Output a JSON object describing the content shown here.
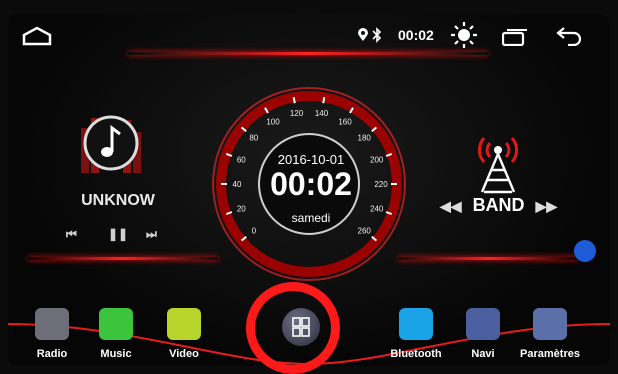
{
  "status_bar": {
    "home_icon": "home-outline-icon",
    "location_icon": "location-pin-icon",
    "bluetooth_icon": "bluetooth-icon",
    "time": "00:02",
    "brightness_icon": "brightness-icon",
    "recents_icon": "recent-apps-icon",
    "back_icon": "back-arrow-icon"
  },
  "music_widget": {
    "title": "UNKNOW",
    "prev_label": "⏮",
    "pause_label": "❚❚",
    "next_label": "⏭"
  },
  "clock_widget": {
    "date": "2016-10-01",
    "time": "00:02",
    "day": "samedi",
    "speed_ticks": [
      "0",
      "20",
      "40",
      "60",
      "80",
      "100",
      "120",
      "140",
      "160",
      "180",
      "200",
      "220",
      "240",
      "260"
    ]
  },
  "radio_widget": {
    "band_label": "BAND",
    "prev_label": "◀◀",
    "next_label": "▶▶"
  },
  "dock": {
    "items": [
      {
        "label": "Radio",
        "icon": "radio-icon",
        "color": "#6e6e78"
      },
      {
        "label": "Music",
        "icon": "music-note-icon",
        "color": "#3cc43c"
      },
      {
        "label": "Video",
        "icon": "video-icon",
        "color": "#b9d42a"
      },
      {
        "label": "Bluetooth",
        "icon": "bluetooth-icon",
        "color": "#1aa3e6"
      },
      {
        "label": "Navi",
        "icon": "compass-icon",
        "color": "#4b5fa0"
      },
      {
        "label": "Paramètres",
        "icon": "settings-icon",
        "color": "#5b6fa8"
      }
    ],
    "apps_icon": "app-grid-icon"
  },
  "colors": {
    "accent": "#ff2020",
    "highlight_ring": "#ff1a1a",
    "assist_dot": "#1e5bd8"
  }
}
